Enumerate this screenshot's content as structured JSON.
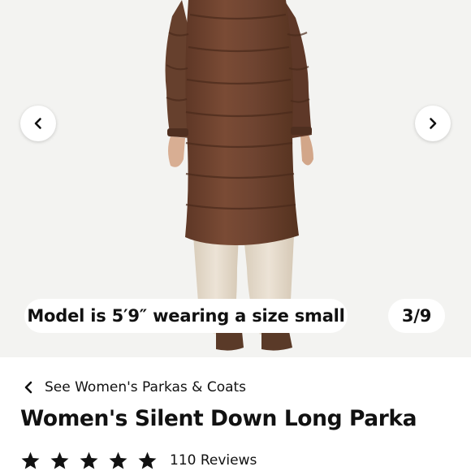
{
  "gallery": {
    "model_info": "Model is 5′9″ wearing a size small",
    "counter": "3/9",
    "prev_icon": "chevron-left-icon",
    "next_icon": "chevron-right-icon",
    "image": "product-photo",
    "colors": {
      "background": "#f3f3f1",
      "coat": "#6e4330",
      "pants": "#e6dccd",
      "boots": "#5a3a28"
    }
  },
  "breadcrumb": {
    "icon": "chevron-left-icon",
    "label": "See Women's Parkas & Coats"
  },
  "product": {
    "title": "Women's Silent Down Long Parka",
    "rating": 5,
    "rating_max": 5,
    "reviews_label": "110 Reviews",
    "star_icon": "star-icon"
  }
}
